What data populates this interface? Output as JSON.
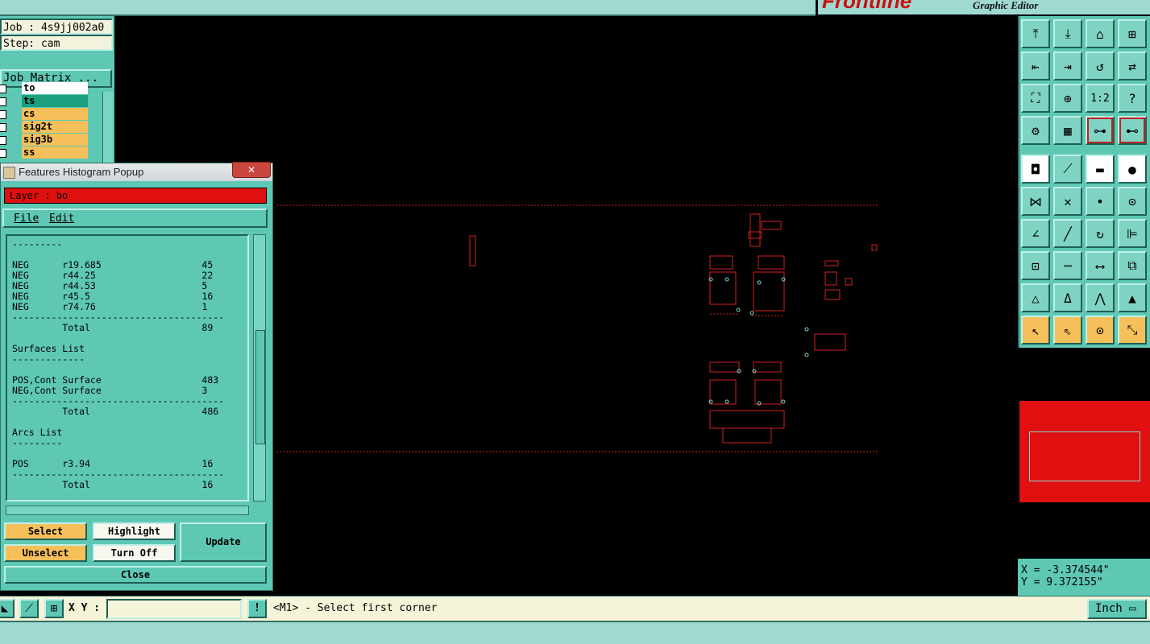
{
  "app": {
    "logo_text": "Frontline",
    "editor_title": "Graphic Editor"
  },
  "job_panel": {
    "job": "Job : 4s9jj002a0",
    "step": "Step: cam",
    "matrix_button": "Job Matrix ...",
    "layers": [
      {
        "name": "to",
        "color": "#ffffff"
      },
      {
        "name": "ts",
        "color": "#1aa07e"
      },
      {
        "name": "cs",
        "color": "#f5c05a"
      },
      {
        "name": "sig2t",
        "color": "#f5c05a"
      },
      {
        "name": "sig3b",
        "color": "#f5c05a"
      },
      {
        "name": "ss",
        "color": "#f5c05a"
      }
    ]
  },
  "popup": {
    "title": "Features Histogram Popup",
    "close_glyph": "✕",
    "layer_label": "Layer :  bo",
    "menu": {
      "file": "File",
      "edit": "Edit"
    },
    "report": [
      "---------",
      "",
      "NEG      r19.685                  45",
      "NEG      r44.25                   22",
      "NEG      r44.53                   5",
      "NEG      r45.5                    16",
      "NEG      r74.76                   1",
      "--------------------------------------",
      "         Total                    89",
      "",
      "Surfaces List",
      "-------------",
      "",
      "POS,Cont Surface                  483",
      "NEG,Cont Surface                  3",
      "--------------------------------------",
      "         Total                    486",
      "",
      "Arcs List",
      "---------",
      "",
      "POS      r3.94                    16",
      "--------------------------------------",
      "         Total                    16"
    ],
    "buttons": {
      "select": "Select",
      "highlight": "Highlight",
      "unselect": "Unselect",
      "turn_off": "Turn Off",
      "update": "Update",
      "close": "Close"
    }
  },
  "toolbar": {
    "tools": [
      "load-layer-icon",
      "save-layer-icon",
      "home-icon",
      "zoom-window-icon",
      "pan-left-icon",
      "pan-right-icon",
      "rotate-icon",
      "mirror-icon",
      "zoom-fit-icon",
      "zoom-center-icon",
      "one-to-two-icon",
      "help-icon",
      "settings-icon",
      "grid-icon",
      "snap-red-icon",
      "snap-active-icon",
      "pad-icon",
      "line-draw-icon",
      "ruler-icon",
      "circle-fill-icon",
      "connect-icon",
      "cross-icon",
      "node-icon",
      "node-add-icon",
      "angle-icon",
      "slash-icon",
      "arc-icon",
      "align-icon",
      "move-node-icon",
      "minus-icon",
      "measure-icon",
      "group-icon",
      "triangle-1-icon",
      "triangle-2-icon",
      "triangle-3-icon",
      "triangle-4-icon",
      "pointer-icon",
      "select-pointer-icon",
      "select-circle-icon",
      "select-drag-icon"
    ],
    "glyphs": [
      "⤒",
      "⤓",
      "⌂",
      "⊞",
      "⇤",
      "⇥",
      "↺",
      "⇄",
      "⛶",
      "⊕",
      "1:2",
      "?",
      "⚙",
      "▦",
      "⊶",
      "⊷",
      "◘",
      "⟋",
      "▬",
      "●",
      "⋈",
      "✕",
      "•",
      "⊙",
      "∠",
      "╱",
      "↻",
      "⊫",
      "⊡",
      "─",
      "⟷",
      "⧉",
      "△",
      "Δ",
      "⋀",
      "▲",
      "↖",
      "⇖",
      "⊙",
      "⤡"
    ],
    "colors": [
      "#7fd3c3",
      "#ffffff",
      "#f5c05a",
      "#c02020"
    ]
  },
  "coords": {
    "x": "X = -3.374544\"",
    "y": "Y = 9.372155\""
  },
  "status": {
    "xy_label": "X Y :",
    "xy_value": "",
    "bang": "!",
    "prompt": "<M1> - Select first corner",
    "unit": "Inch ▭"
  }
}
